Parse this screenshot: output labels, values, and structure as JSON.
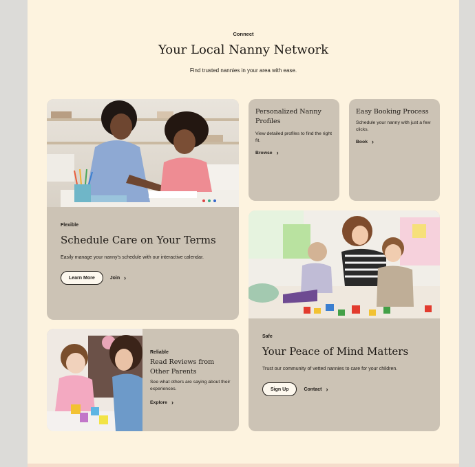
{
  "header": {
    "eyebrow": "Connect",
    "title": "Your Local Nanny Network",
    "subtitle": "Find trusted nannies in your area with ease."
  },
  "cards": {
    "schedule": {
      "eyebrow": "Flexible",
      "title": "Schedule Care on Your Terms",
      "description": "Easily manage your nanny's schedule with our interactive calendar.",
      "button": "Learn More",
      "link": "Join",
      "image_icon": "tutor-child-drawing-photo"
    },
    "profiles": {
      "title": "Personalized Nanny Profiles",
      "description": "View detailed profiles to find the right fit.",
      "link": "Browse"
    },
    "booking": {
      "title": "Easy Booking Process",
      "description": "Schedule your nanny with just a few clicks.",
      "link": "Book"
    },
    "reviews": {
      "eyebrow": "Reliable",
      "title": "Read Reviews from Other Parents",
      "description": "See what others are saying about their experiences.",
      "link": "Explore",
      "image_icon": "nanny-toddler-cups-photo"
    },
    "peace": {
      "eyebrow": "Safe",
      "title": "Your Peace of Mind Matters",
      "description": "Trust our community of vetted nannies to care for your children.",
      "button": "Sign Up",
      "link": "Contact",
      "image_icon": "nanny-kids-blocks-photo"
    }
  },
  "colors": {
    "page_bg": "#fdf3df",
    "card_bg": "#ccc3b5",
    "outer_bg": "#dcdbd8",
    "text": "#1e1a16"
  }
}
